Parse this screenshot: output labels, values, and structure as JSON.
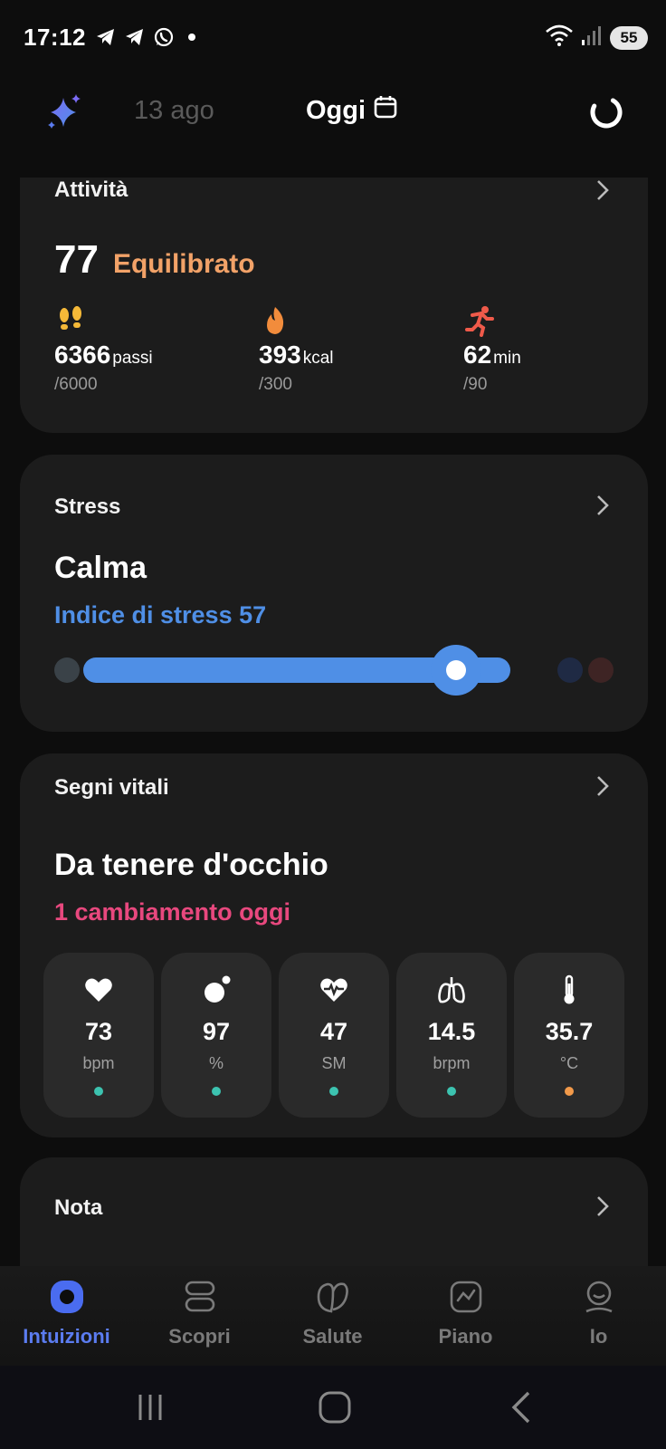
{
  "status_bar": {
    "time": "17:12",
    "battery": "55",
    "left_icons": [
      "telegram-icon",
      "telegram-icon",
      "whatsapp-icon",
      "dot-icon"
    ],
    "right_icons": [
      "wifi-icon",
      "signal-icon",
      "battery-icon"
    ]
  },
  "top_nav": {
    "prev_date": "13 ago",
    "current_date": "Oggi",
    "icons": [
      "sparkle-icon",
      "calendar-icon",
      "sync-icon"
    ]
  },
  "activity": {
    "title": "Attività",
    "score": "77",
    "status": "Equilibrato",
    "status_color": "#f2a268",
    "metrics": [
      {
        "icon": "footsteps-icon",
        "value": "6366",
        "unit": "passi",
        "goal": "/6000",
        "color": "#f5b938"
      },
      {
        "icon": "flame-icon",
        "value": "393",
        "unit": "kcal",
        "goal": "/300",
        "color": "#f28c3c"
      },
      {
        "icon": "running-icon",
        "value": "62",
        "unit": "min",
        "goal": "/90",
        "color": "#ef5a4a"
      }
    ]
  },
  "stress": {
    "title": "Stress",
    "state": "Calma",
    "index_label": "Indice di stress",
    "index_value": "57",
    "accent": "#4f8fe6",
    "level": 0.79
  },
  "vitals": {
    "title": "Segni vitali",
    "state": "Da tenere d'occhio",
    "change": "1 cambiamento oggi",
    "change_color": "#e8487e",
    "tiles": [
      {
        "icon": "heart-icon",
        "value": "73",
        "unit": "bpm",
        "dot": "#3cc3b0"
      },
      {
        "icon": "oxygen-icon",
        "value": "97",
        "unit": "%",
        "dot": "#3cc3b0"
      },
      {
        "icon": "heart-rate-variability-icon",
        "value": "47",
        "unit": "SM",
        "dot": "#3cc3b0"
      },
      {
        "icon": "lungs-icon",
        "value": "14.5",
        "unit": "brpm",
        "dot": "#3cc3b0"
      },
      {
        "icon": "thermometer-icon",
        "value": "35.7",
        "unit": "°C",
        "dot": "#f29a4a"
      }
    ]
  },
  "note": {
    "title": "Nota"
  },
  "tabs": [
    {
      "label": "Intuizioni",
      "icon": "insights-icon",
      "active": true
    },
    {
      "label": "Scopri",
      "icon": "discover-icon",
      "active": false
    },
    {
      "label": "Salute",
      "icon": "health-icon",
      "active": false
    },
    {
      "label": "Piano",
      "icon": "plan-icon",
      "active": false
    },
    {
      "label": "Io",
      "icon": "profile-icon",
      "active": false
    }
  ],
  "system_nav": [
    "recent-apps-icon",
    "home-icon",
    "back-icon"
  ]
}
